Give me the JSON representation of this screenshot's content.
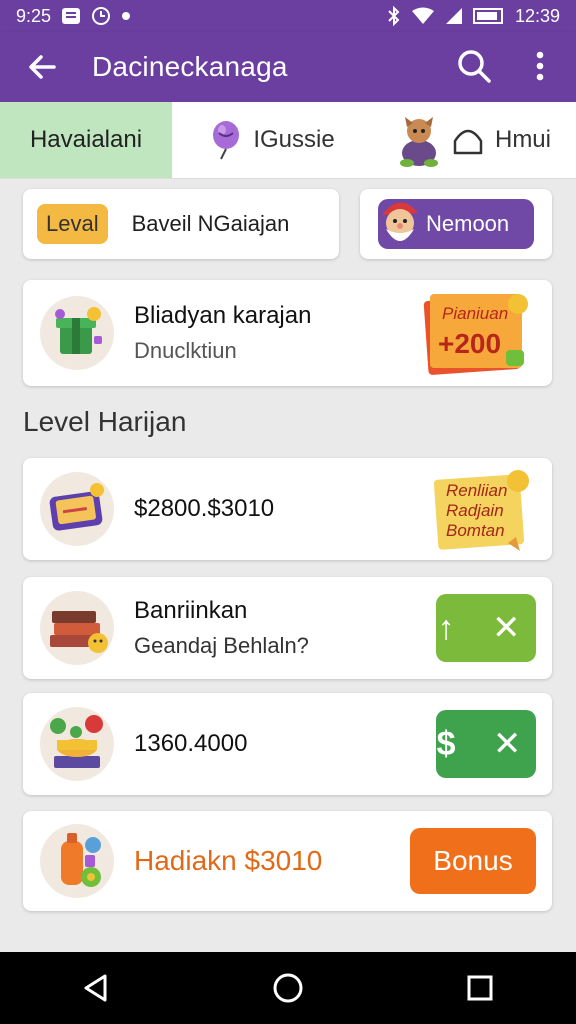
{
  "statusbar": {
    "time_left": "9:25",
    "time_right": "12:39"
  },
  "appbar": {
    "title": "Dacineckanaga"
  },
  "tabs": [
    {
      "label": "Havaialani"
    },
    {
      "label": "IGussie"
    },
    {
      "label": "Hmui"
    }
  ],
  "level_card": {
    "badge": "Leval",
    "text": "Baveil NGaiajan"
  },
  "member_button": {
    "label": "Nemoon"
  },
  "rows": {
    "reward": {
      "title": "Bliadyan karajan",
      "subtitle": "Dnuclktiun",
      "promo_title": "Pianiuan",
      "promo_value": "+200"
    },
    "section_title": "Level Harijan",
    "range": {
      "title": "$2800.$3010",
      "promo_lines": [
        "Renliian",
        "Radjain",
        "Bomtan"
      ]
    },
    "books": {
      "title": "Banriinkan",
      "subtitle": "Geandaj Behlaln?",
      "badge": "↑ ✕"
    },
    "amount": {
      "title": "1360.4000",
      "badge": "$ ✕"
    },
    "bonus": {
      "title": "Hadiakn $3010",
      "button": "Bonus"
    }
  },
  "colors": {
    "primary": "#6b3fa0",
    "active_tab": "#bfe6bf",
    "accent_orange": "#ef6f1a",
    "green_light": "#7cba3c",
    "green_dark": "#3fa34d"
  }
}
